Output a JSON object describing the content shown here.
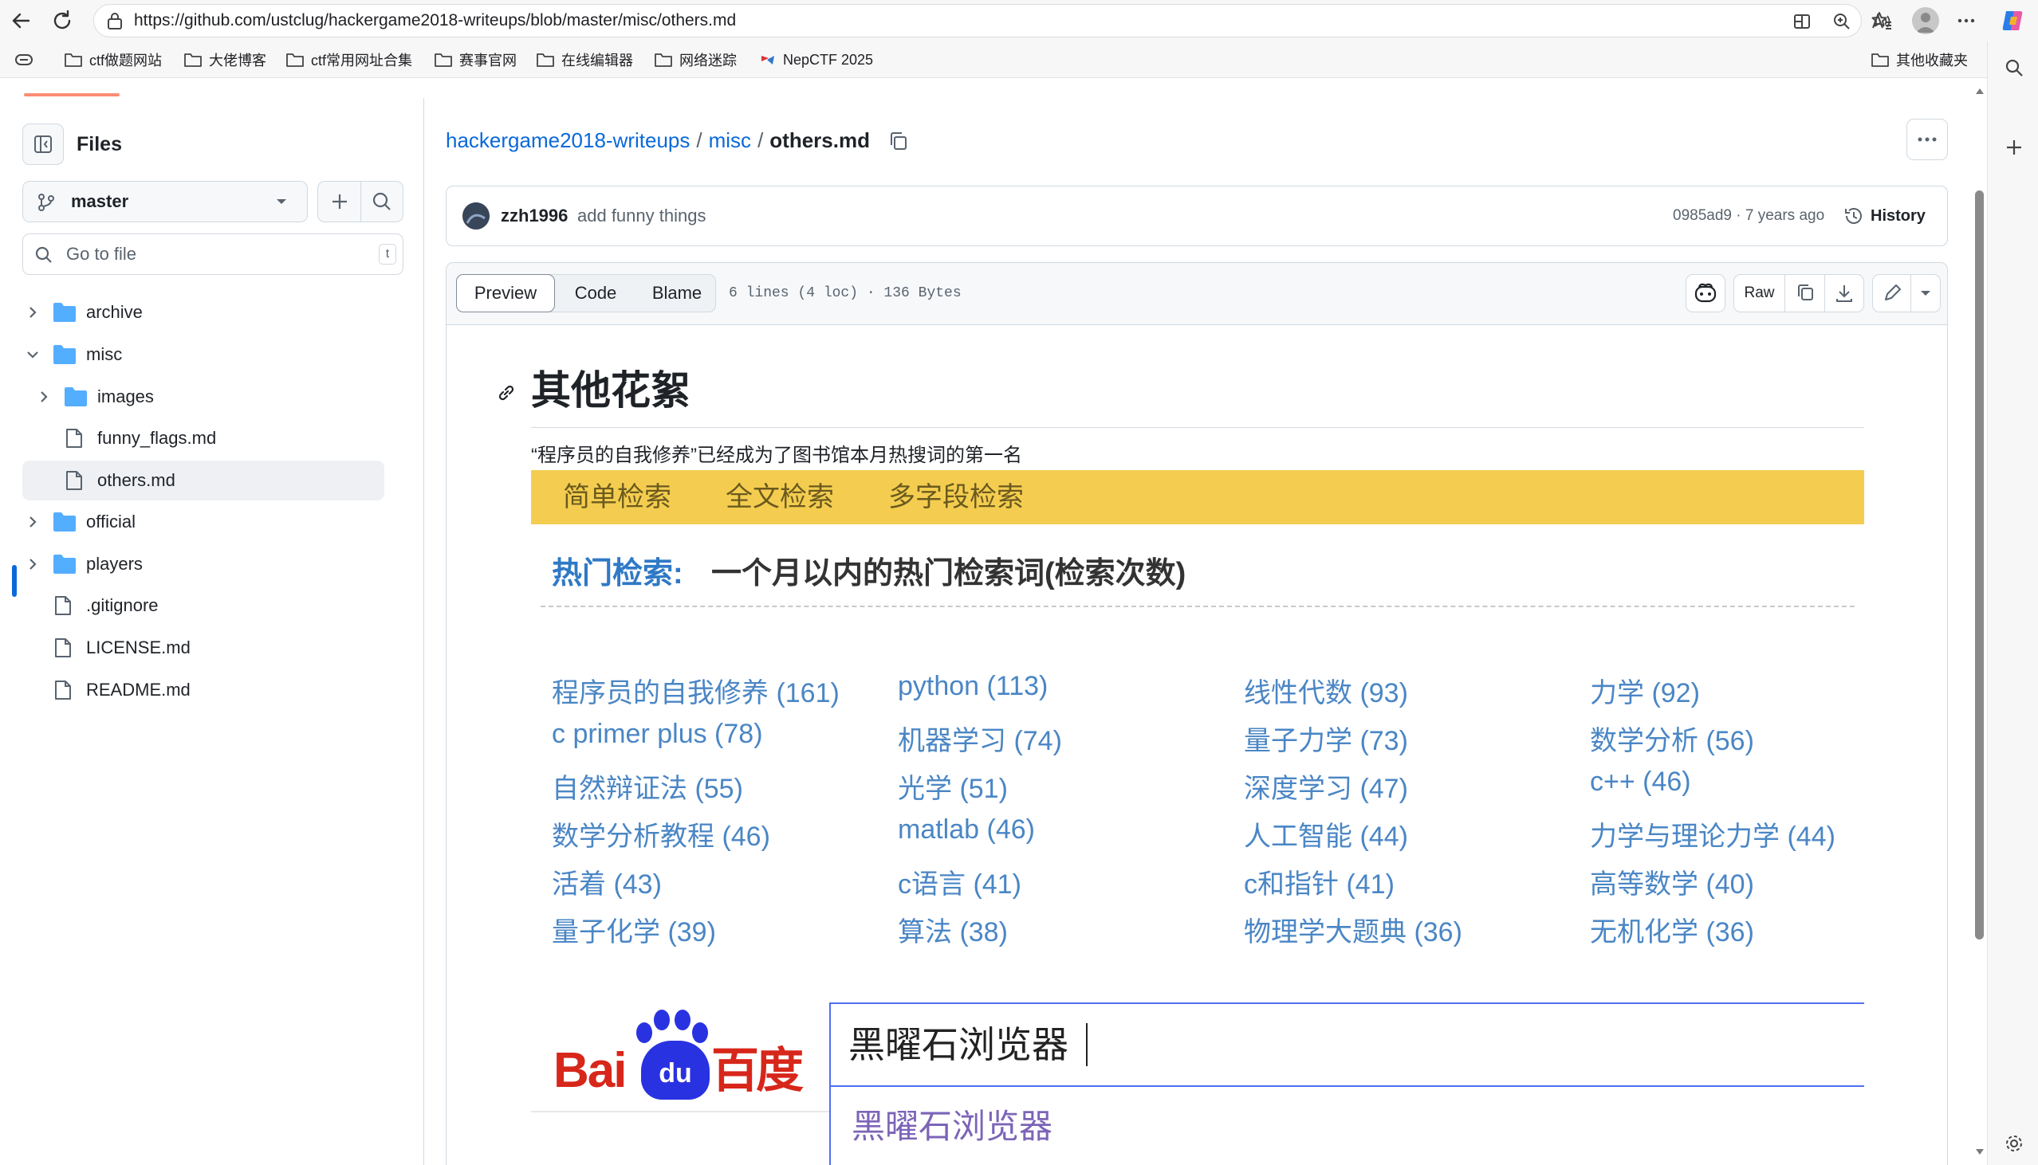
{
  "browser": {
    "url": "https://github.com/ustclug/hackergame2018-writeups/blob/master/misc/others.md",
    "bookmarks": [
      "ctf做题网站",
      "大佬博客",
      "ctf常用网址合集",
      "赛事官网",
      "在线编辑器",
      "网络迷踪",
      "NepCTF 2025"
    ],
    "other_bookmarks": "其他收藏夹"
  },
  "sidebar": {
    "title": "Files",
    "branch": "master",
    "search_placeholder": "Go to file",
    "search_shortcut": "t",
    "tree": [
      {
        "label": "archive",
        "type": "folder",
        "expanded": false
      },
      {
        "label": "misc",
        "type": "folder",
        "expanded": true
      },
      {
        "label": "images",
        "type": "folder",
        "expanded": false
      },
      {
        "label": "funny_flags.md",
        "type": "file"
      },
      {
        "label": "others.md",
        "type": "file",
        "selected": true
      },
      {
        "label": "official",
        "type": "folder",
        "expanded": false
      },
      {
        "label": "players",
        "type": "folder",
        "expanded": false
      },
      {
        "label": ".gitignore",
        "type": "file"
      },
      {
        "label": "LICENSE.md",
        "type": "file"
      },
      {
        "label": "README.md",
        "type": "file"
      }
    ]
  },
  "breadcrumb": {
    "repo": "hackergame2018-writeups",
    "sep1": "/",
    "folder": "misc",
    "sep2": "/",
    "file": "others.md"
  },
  "commit": {
    "author": "zzh1996",
    "message": "add funny things",
    "meta": "0985ad9 · 7 years ago",
    "history_label": "History"
  },
  "file_header": {
    "tabs": [
      "Preview",
      "Code",
      "Blame"
    ],
    "active_tab": "Preview",
    "info": "6 lines (4 loc) · 136 Bytes",
    "raw_label": "Raw"
  },
  "content": {
    "heading": "其他花絮",
    "paragraph": "“程序员的自我修养”已经成为了图书馆本月热搜词的第一名",
    "library_tabs": [
      "简单检索",
      "全文检索",
      "多字段检索"
    ],
    "hot_label": "热门检索:",
    "hot_desc": "一个月以内的热门检索词(检索次数)",
    "hot_terms": [
      [
        "程序员的自我修养 (161)",
        "python (113)",
        "线性代数 (93)",
        "力学 (92)"
      ],
      [
        "c primer plus (78)",
        "机器学习 (74)",
        "量子力学 (73)",
        "数学分析 (56)"
      ],
      [
        "自然辩证法 (55)",
        "光学 (51)",
        "深度学习 (47)",
        "c++ (46)"
      ],
      [
        "数学分析教程 (46)",
        "matlab (46)",
        "人工智能 (44)",
        "力学与理论力学 (44)"
      ],
      [
        "活着 (43)",
        "c语言 (41)",
        "c和指针 (41)",
        "高等数学 (40)"
      ],
      [
        "量子化学 (39)",
        "算法 (38)",
        "物理学大题典 (36)",
        "无机化学 (36)"
      ]
    ],
    "baidu_logo": {
      "bai": "Bai",
      "du": "du",
      "cn": "百度"
    },
    "baidu_query": "黑曜石浏览器",
    "baidu_suggestion": "黑曜石浏览器"
  },
  "colors": {
    "accent": "#0969da",
    "library_bar": "#f4cd50",
    "hot_link": "#4a86c5",
    "baidu_red": "#d7261a",
    "baidu_blue": "#2932e1"
  }
}
